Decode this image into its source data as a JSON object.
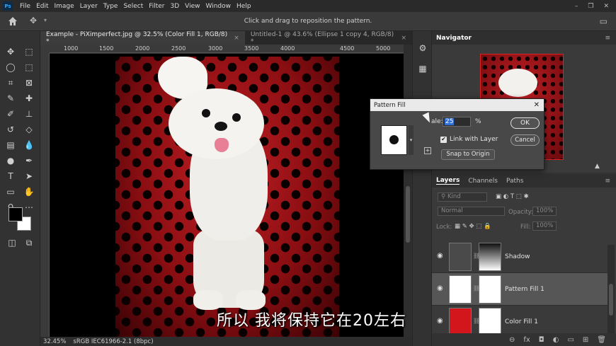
{
  "menu": {
    "logo": "Ps",
    "items": [
      "File",
      "Edit",
      "Image",
      "Layer",
      "Type",
      "Select",
      "Filter",
      "3D",
      "View",
      "Window",
      "Help"
    ],
    "window_controls": [
      "–",
      "❐",
      "✕"
    ]
  },
  "options_bar": {
    "message": "Click and drag to reposition the pattern."
  },
  "tabs": [
    {
      "label": "Example - PiXimperfect.jpg @ 32.5% (Color Fill 1, RGB/8) *",
      "close": "×"
    },
    {
      "label": "Untitled-1 @ 43.6% (Ellipse 1 copy 4, RGB/8) *",
      "close": "×"
    }
  ],
  "ruler": {
    "ticks": [
      "1000",
      "1500",
      "2000",
      "2500",
      "3000",
      "3500",
      "4000",
      "4500",
      "5000"
    ]
  },
  "subtitle": "所以 我将保持它在20左右",
  "status": {
    "zoom": "32.45%",
    "profile": "sRGB IEC61966-2.1 (8bpc)"
  },
  "navigator": {
    "title": "Navigator"
  },
  "dialog": {
    "title": "Pattern Fill",
    "scale_label": "ale:",
    "scale_value": "25",
    "percent": "%",
    "link_label": "Link with Layer",
    "snap_label": "Snap to Origin",
    "ok_label": "OK",
    "cancel_label": "Cancel"
  },
  "layers_panel": {
    "tabs": [
      "Layers",
      "Channels",
      "Paths"
    ],
    "filter_placeholder": "Kind",
    "blend_mode": "Normal",
    "opacity_label": "Opacity:",
    "opacity_value": "100%",
    "lock_label": "Lock:",
    "fill_label": "Fill:",
    "fill_value": "100%",
    "layers": [
      {
        "name": "Shadow",
        "thumb_color": "#4a4a4a",
        "selected": false
      },
      {
        "name": "Pattern Fill 1",
        "thumb_color": "#ffffff",
        "selected": true
      },
      {
        "name": "Color Fill 1",
        "thumb_color": "#d2161c",
        "selected": false
      }
    ]
  },
  "colors": {
    "foreground": "#000000",
    "background": "#ffffff",
    "accent": "#2f6fd6"
  }
}
